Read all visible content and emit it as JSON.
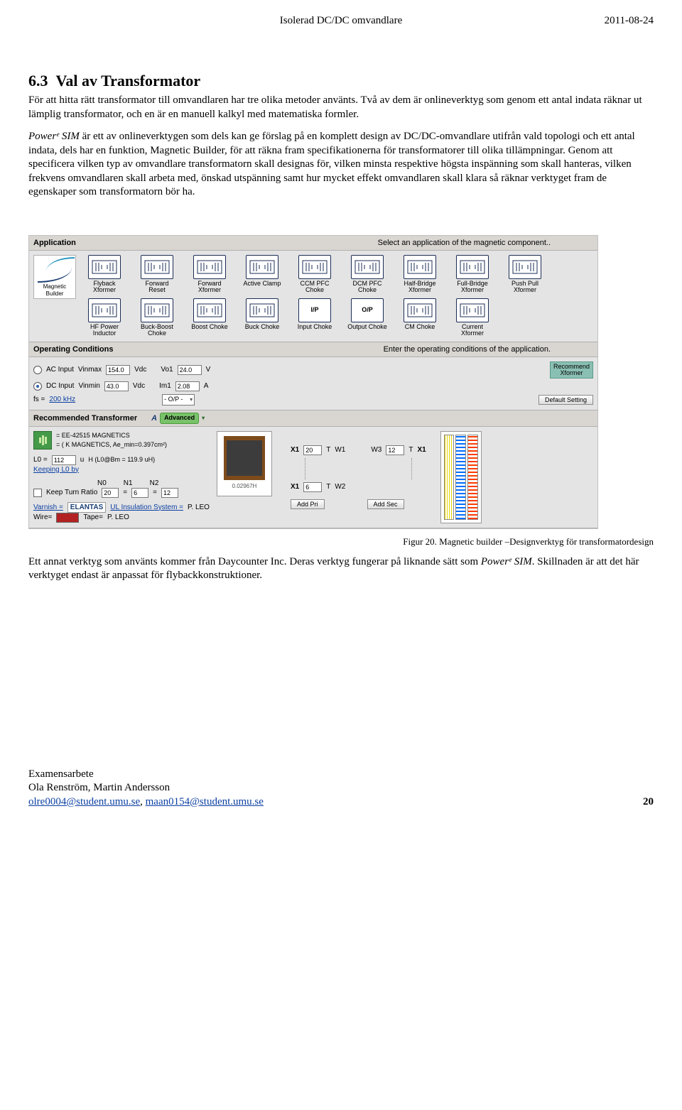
{
  "header": {
    "center": "Isolerad DC/DC omvandlare",
    "date": "2011-08-24"
  },
  "section": {
    "number": "6.3",
    "title": "Val av Transformator"
  },
  "para1": "För att hitta rätt transformator till omvandlaren har tre olika metoder använts. Två av dem är onlineverktyg som genom ett antal indata räknar ut lämplig transformator, och en är en manuell kalkyl med matematiska formler.",
  "math_inline": "Powerᵉ SIM",
  "para2a": " är ett av onlineverktygen som dels kan ge förslag på en komplett design av DC/DC-omvandlare utifrån vald topologi och ett antal indata, dels har en funktion, Magnetic Builder, för att räkna fram specifikationerna för transformatorer till olika tillämpningar. Genom att specificera vilken typ av omvandlare transformatorn skall designas för, vilken minsta respektive högsta inspänning som skall hanteras, vilken frekvens omvandlaren skall arbeta med, önskad utspänning samt hur mycket effekt omvandlaren skall klara så räknar verktyget fram de egenskaper som transformatorn bör ha.",
  "caption": "Figur 20. Magnetic builder –Designverktyg för transformatordesign",
  "para3a": "Ett annat verktyg som använts kommer från Daycounter Inc. Deras verktyg fungerar på liknande sätt som ",
  "para3b": ". Skillnaden är att det här verktyget endast är anpassat för flybackkonstruktioner.",
  "app": {
    "logo": {
      "name1": "Magnetic",
      "name2": "Builder"
    },
    "application": {
      "title": "Application",
      "hint": "Select an application of the magnetic component..",
      "tiles": [
        {
          "id": "flyback-xformer",
          "label": "Flyback\nXformer"
        },
        {
          "id": "forward-reset",
          "label": "Forward\nReset"
        },
        {
          "id": "forward-xformer",
          "label": "Forward\nXformer"
        },
        {
          "id": "active-clamp",
          "label": "Active Clamp"
        },
        {
          "id": "ccm-pfc-choke",
          "label": "CCM PFC\nChoke"
        },
        {
          "id": "dcm-pfc-choke",
          "label": "DCM PFC\nChoke"
        },
        {
          "id": "half-bridge-xformer",
          "label": "Half-Bridge\nXformer"
        },
        {
          "id": "full-bridge-xformer",
          "label": "Full-Bridge\nXformer"
        },
        {
          "id": "push-pull-xformer",
          "label": "Push Pull\nXformer"
        },
        {
          "id": "hf-power-inductor",
          "label": "HF Power\nInductor"
        },
        {
          "id": "buck-boost-choke",
          "label": "Buck-Boost\nChoke"
        },
        {
          "id": "boost-choke",
          "label": "Boost Choke"
        },
        {
          "id": "buck-choke",
          "label": "Buck Choke"
        },
        {
          "id": "input-choke",
          "label": "Input Choke",
          "iop": "I/P"
        },
        {
          "id": "output-choke",
          "label": "Output Choke",
          "iop": "O/P"
        },
        {
          "id": "cm-choke",
          "label": "CM Choke"
        },
        {
          "id": "current-xformer",
          "label": "Current\nXformer"
        }
      ]
    },
    "oc": {
      "title": "Operating Conditions",
      "hint": "Enter the operating conditions of the application.",
      "ac_label": "AC Input",
      "dc_label": "DC Input",
      "vinmax_label": "Vinmax",
      "vinmax_val": "154.0",
      "vdc_u1": "Vdc",
      "vinmin_label": "Vinmin",
      "vinmin_val": "43.0",
      "vdc_u2": "Vdc",
      "vo1_label": "Vo1",
      "vo1_val": "24.0",
      "vo1_unit": "V",
      "im1_label": "Im1",
      "im1_val": "2.08",
      "im1_unit": "A",
      "fs_label": "fs =",
      "fs_val": "200 kHz",
      "iop_sel": "- O/P -",
      "rec_btn": "Recommend\nXformer",
      "def_btn": "Default Setting"
    },
    "rt": {
      "title": "Recommended Transformer",
      "advanced": "Advanced",
      "core_line1": "= EE-42515 MAGNETICS",
      "core_line2": "= ( K MAGNETICS, Ae_min=0.397cm²)",
      "l0_pref": "L0 =",
      "l0_val": "112",
      "l0_unit": "u",
      "l0_note": "H (L0@Bm = 119.9 uH)",
      "keep_l0": "Keeping L0 by",
      "n0": "N0",
      "n1": "N1",
      "n2": "N2",
      "keep_turn": "Keep Turn Ratio",
      "ktr0": "20",
      "ktr1": "6",
      "ktr2": "12",
      "varnish": "Varnish =",
      "varnish_brand": "ELANTAS",
      "uli": "UL Insulation System =",
      "uli_val": "P. LEO",
      "wire": "Wire=",
      "tape": "Tape=",
      "tape_val": "P. LEO",
      "x1_lab": "X1",
      "x1_val": "20",
      "t1": "T",
      "w1_lab": "W1",
      "x2_lab": "X1",
      "x2_val": "6",
      "t2": "T",
      "w2_lab": "W2",
      "w3_lab": "W3",
      "w3_val": "12",
      "t3": "T",
      "x3_lab": "X1",
      "addpri": "Add Pri",
      "addsec": "Add Sec",
      "photo_caption": "0.02967H"
    }
  },
  "foot": {
    "l1": "Examensarbete",
    "l2": "Ola Renström, Martin Andersson",
    "e1": "olre0004@student.umu.se",
    "sep": ", ",
    "e2": "maan0154@student.umu.se",
    "page": "20"
  }
}
